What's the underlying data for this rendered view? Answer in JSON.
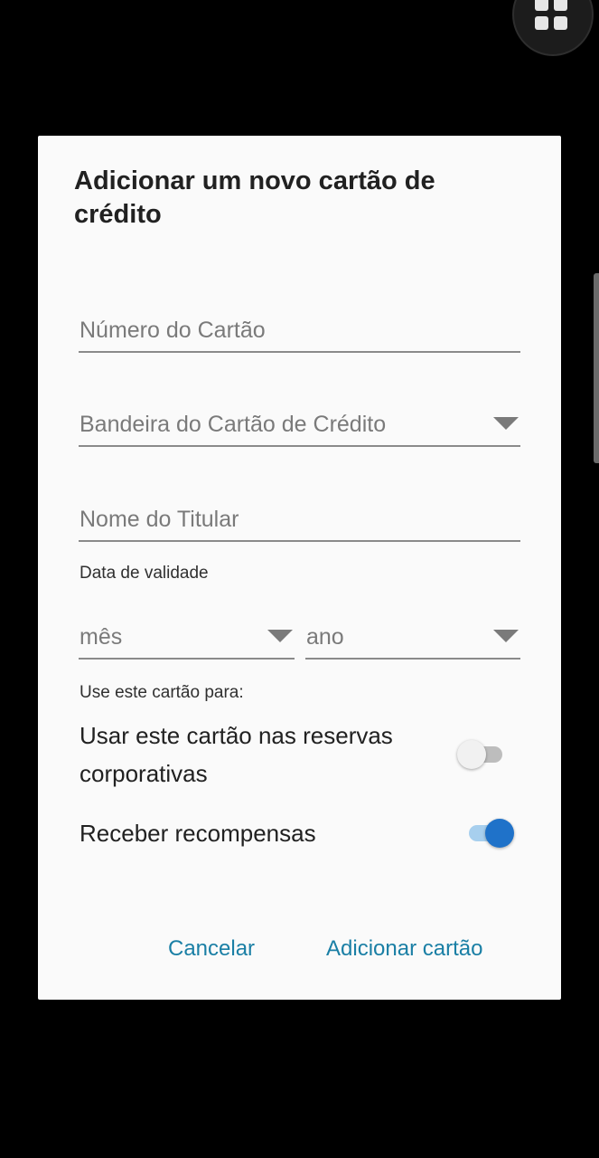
{
  "app_grid_button": {
    "icon": "grid-icon"
  },
  "dialog": {
    "title": "Adicionar um novo cartão de crédito",
    "fields": {
      "card_number": {
        "placeholder": "Número do Cartão"
      },
      "card_brand": {
        "placeholder": "Bandeira do Cartão de Crédito"
      },
      "holder_name": {
        "placeholder": "Nome do Titular"
      }
    },
    "expiry": {
      "label": "Data de validade",
      "month_placeholder": "mês",
      "year_placeholder": "ano"
    },
    "usage": {
      "label": "Use este cartão para:",
      "corporate": {
        "label": "Usar este cartão nas reservas corporativas",
        "enabled": false
      },
      "rewards": {
        "label": "Receber recompensas",
        "enabled": true
      }
    },
    "buttons": {
      "cancel": "Cancelar",
      "add": "Adicionar cartão"
    }
  },
  "colors": {
    "accent": "#1a7fa5",
    "switch_on_thumb": "#1f72c9",
    "switch_on_track": "#a7cfee",
    "switch_off_thumb": "#f1f1f1",
    "switch_off_track": "#bdbdbd"
  }
}
